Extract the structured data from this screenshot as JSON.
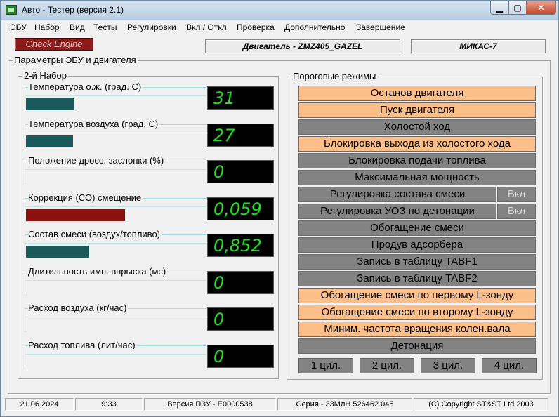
{
  "window": {
    "title": "Авто - Тестер  (версия 2.1)",
    "min_icon": "minimize-icon",
    "max_icon": "maximize-icon",
    "close_icon": "close-icon",
    "min_glyph": "▁",
    "max_glyph": "▢",
    "close_glyph": "✕"
  },
  "menu": [
    "ЭБУ",
    "Набор",
    "Вид",
    "Тесты",
    "Регулировки",
    "Вкл / Откл",
    "Проверка",
    "Дополнительно",
    "Завершение"
  ],
  "header": {
    "check_engine": "Check Engine",
    "engine": "Двигатель - ZMZ405_GAZEL",
    "ecu": "МИКАС-7"
  },
  "params_group": "Параметры ЭБУ и двигателя",
  "set_group": "2-й  Набор",
  "sensors": [
    {
      "label": "Температура  о.ж. (град. С)",
      "value": "31",
      "fill": 0.27,
      "color": "#1a5a5a"
    },
    {
      "label": "Температура воздуха (град. С)",
      "value": "27",
      "fill": 0.26,
      "color": "#1a5a5a"
    },
    {
      "label": "Положение дросс. заслонки (%)",
      "value": "0",
      "fill": 0,
      "color": "#1a5a5a"
    },
    {
      "label": "Коррекция (СО) смещение",
      "value": "0,059",
      "fill": 0.55,
      "color": "#8b1010"
    },
    {
      "label": "Состав смеси (воздух/топливо)",
      "value": "0,852",
      "fill": 0.35,
      "color": "#1a5a5a"
    },
    {
      "label": "Длительность имп. впрыска (мс)",
      "value": "0",
      "fill": 0,
      "color": "#1a5a5a"
    },
    {
      "label": "Расход воздуха (кг/час)",
      "value": "0",
      "fill": 0,
      "color": "#1a5a5a"
    },
    {
      "label": "Расход топлива (лит/час)",
      "value": "0",
      "fill": 0,
      "color": "#1a5a5a"
    }
  ],
  "modes_group": "Пороговые режимы",
  "modes": [
    {
      "label": "Останов двигателя",
      "active": true
    },
    {
      "label": "Пуск двигателя",
      "active": true
    },
    {
      "label": "Холостой ход",
      "active": false
    },
    {
      "label": "Блокировка выхода из холостого хода",
      "active": true
    },
    {
      "label": "Блокировка подачи топлива",
      "active": false
    },
    {
      "label": "Максимальная мощность",
      "active": false
    },
    {
      "label": "Регулировка состава смеси",
      "active": false,
      "toggle": "Вкл"
    },
    {
      "label": "Регулировка УОЗ по детонации",
      "active": false,
      "toggle": "Вкл"
    },
    {
      "label": "Обогащение смеси",
      "active": false
    },
    {
      "label": "Продув адсорбера",
      "active": false
    },
    {
      "label": "Запись в таблицу TABF1",
      "active": false
    },
    {
      "label": "Запись в таблицу TABF2",
      "active": false
    },
    {
      "label": "Обогащение смеси по первому L-зонду",
      "active": true
    },
    {
      "label": "Обогащение смеси по второму L-зонду",
      "active": true
    },
    {
      "label": "Миним. частота вращения колен.вала",
      "active": true
    },
    {
      "label": "Детонация",
      "active": false
    }
  ],
  "cylinders": [
    "1 цил.",
    "2 цил.",
    "3 цил.",
    "4 цил."
  ],
  "status": {
    "date": "21.06.2024",
    "time": "9:33",
    "rom": "Версия ПЗУ - Е0000538",
    "serial": "Серия - 33МлН 526462 045",
    "copyright": "(C) Copyright   ST&ST  Ltd 2003"
  }
}
